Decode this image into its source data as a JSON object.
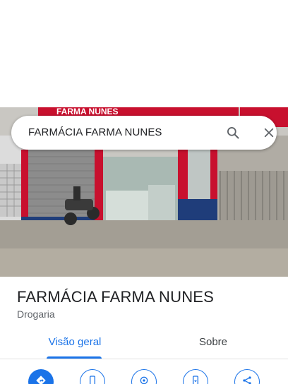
{
  "search": {
    "query": "FARMÁCIA FARMA NUNES",
    "icon": "search-icon",
    "close_icon": "close-icon"
  },
  "photo": {
    "sign_text": "FARMA NUNES",
    "description_colors": {
      "sign_red": "#c8102e",
      "wall_blue": "#1f3d7a",
      "brand_red": "#c8102e"
    }
  },
  "place": {
    "name": "FARMÁCIA FARMA NUNES",
    "category": "Drogaria"
  },
  "tabs": [
    {
      "label": "Visão geral",
      "selected": true
    },
    {
      "label": "Sobre",
      "selected": false
    }
  ],
  "actions": [
    {
      "icon": "directions-icon",
      "primary": true
    },
    {
      "icon": "phone-icon",
      "primary": false
    },
    {
      "icon": "nearby-icon",
      "primary": false
    },
    {
      "icon": "save-to-phone-icon",
      "primary": false
    },
    {
      "icon": "share-icon",
      "primary": false
    }
  ],
  "colors": {
    "accent": "#1a73e8",
    "text_primary": "#202124",
    "text_secondary": "#5f6368"
  }
}
